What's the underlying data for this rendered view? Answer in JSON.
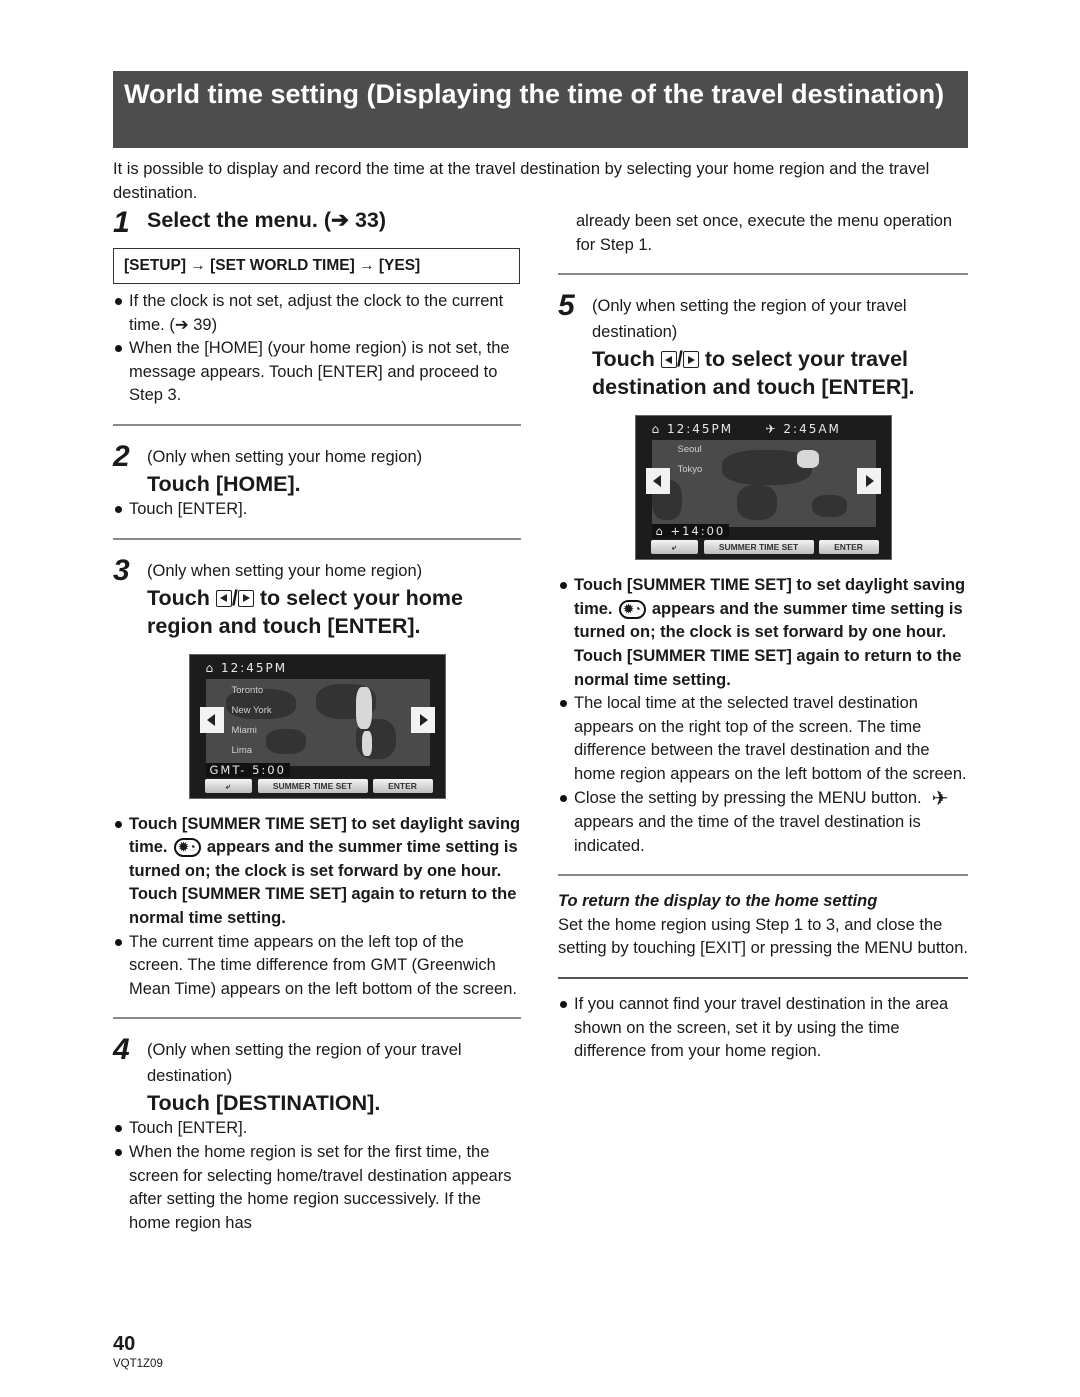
{
  "page": {
    "title": "World time setting (Displaying the time of the travel destination)",
    "intro": "It is possible to display and record the time at the travel destination by selecting your home region and the travel destination.",
    "page_number": "40",
    "doc_code": "VQT1Z09"
  },
  "steps": [
    {
      "number": "1",
      "title": "Select the menu. (➔ 33)",
      "menu_path": "[SETUP] → [SET WORLD TIME] → [YES]",
      "bullets": [
        "If the clock is not set, adjust the clock to the current time. (➔ 39)",
        "When the [HOME] (your home region) is not set, the message appears. Touch [ENTER] and proceed to Step 3."
      ]
    },
    {
      "number": "2",
      "note": "(Only when setting your home region)",
      "title": "Touch [HOME].",
      "bullets": [
        "Touch [ENTER]."
      ]
    },
    {
      "number": "3",
      "note": "(Only when setting your home region)",
      "title_prefix": "Touch",
      "title_suffix": "to select your home region and touch [ENTER].",
      "screen": {
        "home_time": "12:45PM",
        "cities": [
          "Toronto",
          "New York",
          "Miami",
          "Lima"
        ],
        "offset": "GMT- 5:00",
        "buttons": {
          "back": "⤶",
          "summer_time": "SUMMER TIME SET",
          "enter": "ENTER"
        }
      },
      "bullets_bold": [
        "Touch [SUMMER TIME SET] to set daylight saving time.",
        "appears and the summer time setting is turned on; the clock is set forward by one hour. Touch [SUMMER TIME SET] again to return to the normal time setting."
      ],
      "bullets": [
        "The current time appears on the left top of the screen. The time difference from GMT (Greenwich Mean Time) appears on the left bottom of the screen."
      ]
    },
    {
      "number": "4",
      "note": "(Only when setting the region of your travel destination)",
      "title": "Touch [DESTINATION].",
      "bullets": [
        "Touch [ENTER].",
        "When the home region is set for the first time, the screen for selecting home/travel destination appears after setting the home region successively. If the home region has"
      ],
      "continued": "already been set once, execute the menu operation for Step 1."
    },
    {
      "number": "5",
      "note": "(Only when setting the region of your travel destination)",
      "title_prefix": "Touch",
      "title_suffix": "to select your travel destination and touch [ENTER].",
      "screen": {
        "home_time": "12:45PM",
        "dest_time": "2:45AM",
        "cities": [
          "Seoul",
          "Tokyo"
        ],
        "offset": "+14:00",
        "buttons": {
          "back": "⤶",
          "summer_time": "SUMMER TIME SET",
          "enter": "ENTER"
        }
      },
      "bullets_bold": [
        "Touch [SUMMER TIME SET] to set daylight saving time.",
        "appears and the summer time setting is turned on; the clock is set forward by one hour. Touch [SUMMER TIME SET] again to return to the normal time setting."
      ],
      "bullets": [
        "The local time at the selected travel destination appears on the right top of the screen. The time difference between the travel destination and the home region appears on the left bottom of the screen."
      ],
      "close_bullet_before": "Close the setting by pressing the MENU button.",
      "close_bullet_after": "appears and the time of the travel destination is indicated."
    }
  ],
  "return_section": {
    "heading": "To return the display to the home setting",
    "text": "Set the home region using Step 1 to 3, and close the setting by touching [EXIT] or pressing the MENU button."
  },
  "final_note": "If you cannot find your travel destination in the area shown on the screen, set it by using the time difference from your home region.",
  "icons": {
    "summer_time": "✹◔",
    "airplane": "✈",
    "home": "⌂",
    "slash": "/"
  }
}
